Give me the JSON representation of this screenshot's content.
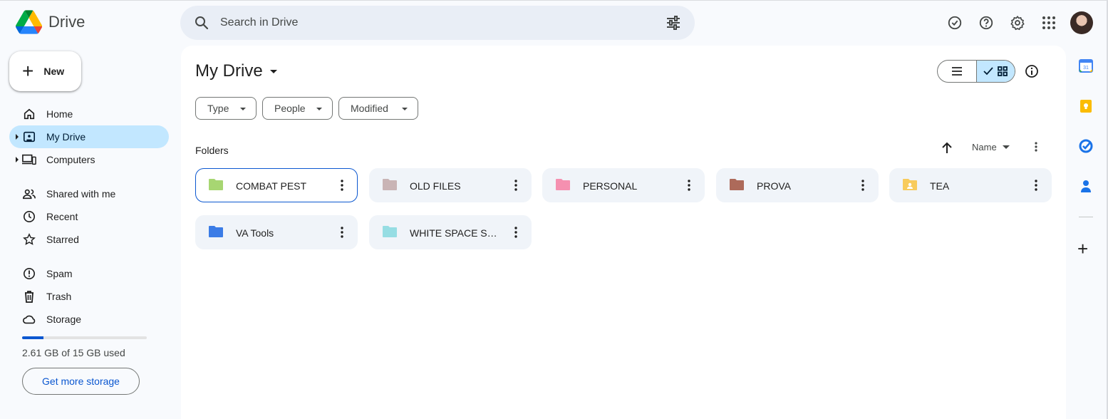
{
  "app": {
    "name": "Drive"
  },
  "search": {
    "placeholder": "Search in Drive"
  },
  "top_icons": [
    "offline-ready-icon",
    "help-icon",
    "settings-icon",
    "apps-icon"
  ],
  "new_button": {
    "label": "New"
  },
  "nav": [
    {
      "label": "Home",
      "icon": "home-icon"
    },
    {
      "label": "My Drive",
      "icon": "my-drive-icon",
      "active": true
    },
    {
      "label": "Computers",
      "icon": "computers-icon"
    },
    {
      "label": "Shared with me",
      "icon": "shared-icon"
    },
    {
      "label": "Recent",
      "icon": "clock-icon"
    },
    {
      "label": "Starred",
      "icon": "star-icon"
    },
    {
      "label": "Spam",
      "icon": "spam-icon"
    },
    {
      "label": "Trash",
      "icon": "trash-icon"
    },
    {
      "label": "Storage",
      "icon": "cloud-icon"
    }
  ],
  "storage": {
    "text": "2.61 GB of 15 GB used",
    "used_fraction": 0.174,
    "button": "Get more storage"
  },
  "main": {
    "title": "My Drive",
    "filters": [
      "Type",
      "People",
      "Modified"
    ],
    "section": "Folders",
    "sort_label": "Name",
    "folders": [
      {
        "name": "COMBAT PEST",
        "color": "#a7d672",
        "selected": true
      },
      {
        "name": "OLD FILES",
        "color": "#c9b4b5"
      },
      {
        "name": "PERSONAL",
        "color": "#f590b0"
      },
      {
        "name": "PROVA",
        "color": "#ad6a5a"
      },
      {
        "name": "TEA",
        "color": "#f8cb5c",
        "shared": true
      },
      {
        "name": "VA Tools",
        "color": "#3b7ce6"
      },
      {
        "name": "WHITE SPACE STUDIO",
        "color": "#96dde3"
      }
    ]
  },
  "side_rail": [
    "calendar-icon",
    "keep-icon",
    "tasks-icon",
    "contacts-icon"
  ],
  "side_rail_calendar_day": "31"
}
